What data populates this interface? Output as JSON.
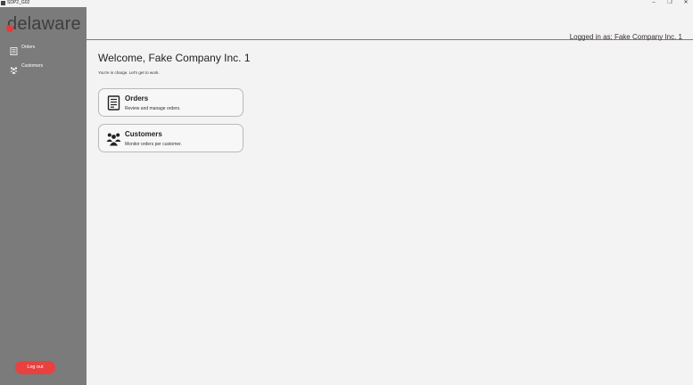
{
  "window": {
    "title": "SDP2_G02",
    "controls": {
      "minimize": "–",
      "maximize": "❐",
      "close": "✕"
    }
  },
  "sidebar": {
    "logo_text": "delaware",
    "items": [
      {
        "label": "Orders",
        "icon": "orders-document-icon"
      },
      {
        "label": "Customers",
        "icon": "customers-group-icon"
      }
    ],
    "logout_label": "Log out"
  },
  "header": {
    "logged_in": "Logged in as: Fake Company Inc. 1"
  },
  "main": {
    "welcome": "Welcome, Fake Company Inc. 1",
    "subtitle": "You're in charge. Let's get to work.",
    "cards": [
      {
        "title": "Orders",
        "description": "Review and manage orders.",
        "icon": "orders-document-icon"
      },
      {
        "title": "Customers",
        "description": "Monitor orders per customer.",
        "icon": "customers-group-icon"
      }
    ]
  },
  "colors": {
    "sidebar_bg": "#7b7b7b",
    "accent_red": "#e8413f",
    "header_line": "#d9534f",
    "page_bg": "#f3f3f3"
  }
}
